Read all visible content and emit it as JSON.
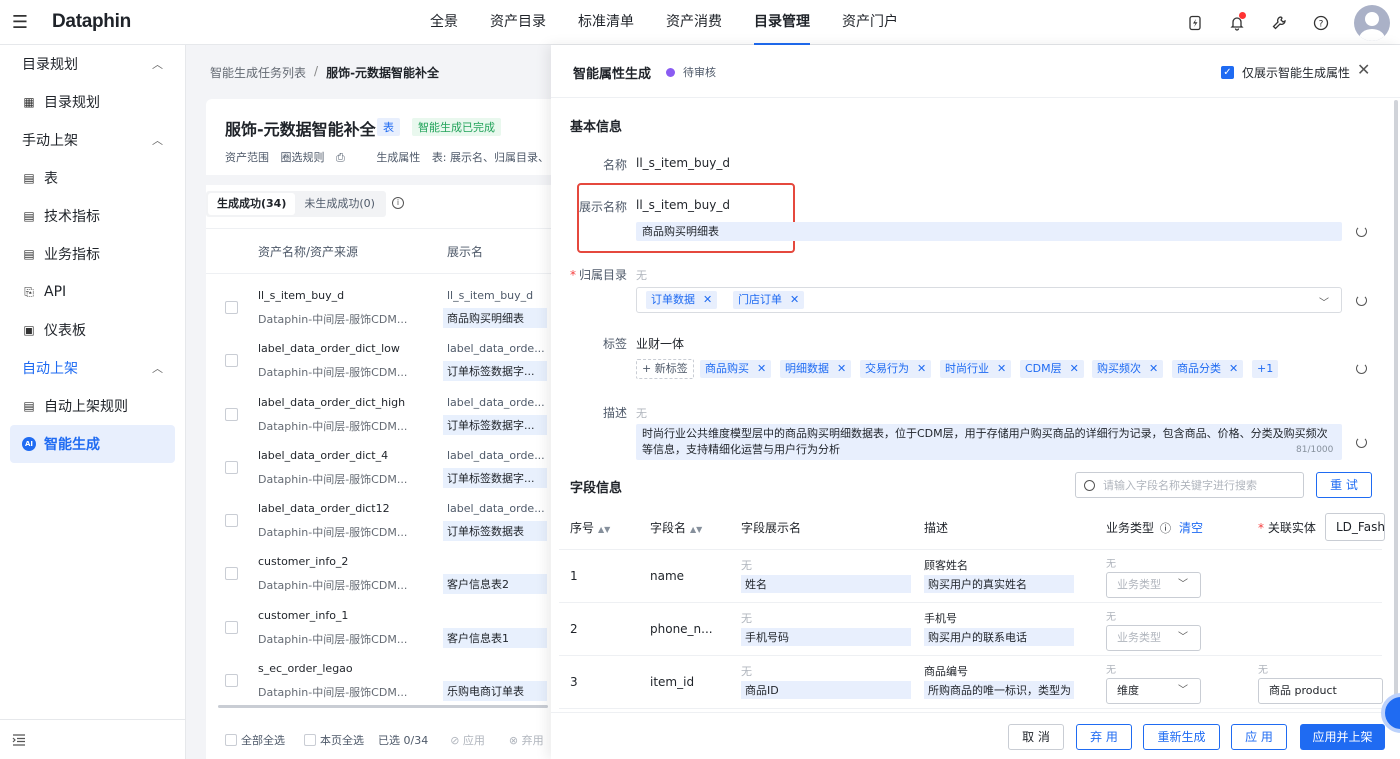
{
  "topbar": {
    "logo": "Dataphin",
    "nav": [
      "全景",
      "资产目录",
      "标准清单",
      "资产消费",
      "目录管理",
      "资产门户"
    ],
    "active_nav": "目录管理"
  },
  "sidebar": {
    "groups": [
      {
        "label": "目录规划",
        "items": [
          {
            "label": "目录规划",
            "icon": "grid-icon"
          }
        ]
      },
      {
        "label": "手动上架",
        "items": [
          {
            "label": "表",
            "icon": "table-icon"
          },
          {
            "label": "技术指标",
            "icon": "metric-icon"
          },
          {
            "label": "业务指标",
            "icon": "biz-metric-icon"
          },
          {
            "label": "API",
            "icon": "api-icon"
          },
          {
            "label": "仪表板",
            "icon": "dashboard-icon"
          }
        ]
      },
      {
        "label": "自动上架",
        "items": [
          {
            "label": "自动上架规则",
            "icon": "rule-icon"
          },
          {
            "label": "智能生成",
            "icon": "ai-icon"
          }
        ]
      }
    ]
  },
  "breadcrumb": {
    "parent": "智能生成任务列表",
    "current": "服饰-元数据智能补全"
  },
  "task": {
    "title": "服饰-元数据智能补全",
    "type_tag": "表",
    "status_tag": "智能生成已完成",
    "meta_scope_label": "资产范围",
    "meta_scope_value": "圈选规则",
    "meta_attr_label": "生成属性",
    "meta_attr_value": "表: 展示名、归属目录、"
  },
  "list": {
    "tab_success": "生成成功(34)",
    "tab_fail": "未生成成功(0)",
    "col_name": "资产名称/资产来源",
    "col_display": "展示名",
    "rows": [
      {
        "name": "ll_s_item_buy_d",
        "source": "Dataphin-中间层-服饰CDM...",
        "display_old": "ll_s_item_buy_d",
        "display_new": "商品购买明细表"
      },
      {
        "name": "label_data_order_dict_low",
        "source": "Dataphin-中间层-服饰CDM...",
        "display_old": "label_data_orde...",
        "display_new": "订单标签数据字..."
      },
      {
        "name": "label_data_order_dict_high",
        "source": "Dataphin-中间层-服饰CDM...",
        "display_old": "label_data_orde...",
        "display_new": "订单标签数据字..."
      },
      {
        "name": "label_data_order_dict_4",
        "source": "Dataphin-中间层-服饰CDM...",
        "display_old": "label_data_orde...",
        "display_new": "订单标签数据字..."
      },
      {
        "name": "label_data_order_dict12",
        "source": "Dataphin-中间层-服饰CDM...",
        "display_old": "label_data_orde...",
        "display_new": "订单标签数据表"
      },
      {
        "name": "customer_info_2",
        "source": "Dataphin-中间层-服饰CDM...",
        "display_old": "",
        "display_new": "客户信息表2"
      },
      {
        "name": "customer_info_1",
        "source": "Dataphin-中间层-服饰CDM...",
        "display_old": "",
        "display_new": "客户信息表1"
      },
      {
        "name": "s_ec_order_legao",
        "source": "Dataphin-中间层-服饰CDM...",
        "display_old": "",
        "display_new": "乐购电商订单表"
      }
    ],
    "footer": {
      "select_all": "全部全选",
      "select_page": "本页全选",
      "selected": "已选 0/34",
      "apply": "应用",
      "discard": "弃用"
    }
  },
  "drawer": {
    "title": "智能属性生成",
    "status": "待审核",
    "only_show_label": "仅展示智能生成属性",
    "basic_title": "基本信息",
    "name_label": "名称",
    "name_value": "ll_s_item_buy_d",
    "display_label": "展示名称",
    "display_value": "ll_s_item_buy_d",
    "display_ai": "商品购买明细表",
    "catalog_label": "归属目录",
    "catalog_value": "无",
    "catalog_chips": [
      "订单数据",
      "门店订单"
    ],
    "tags_label": "标签",
    "tags_value": "业财一体",
    "new_tag": "+ 新标签",
    "tag_chips": [
      "商品购买",
      "明细数据",
      "交易行为",
      "时尚行业",
      "CDM层",
      "购买频次",
      "商品分类"
    ],
    "tag_more": "+1",
    "desc_label": "描述",
    "desc_value": "无",
    "desc_ai": "时尚行业公共维度模型层中的商品购买明细数据表，位于CDM层，用于存储用户购买商品的详细行为记录，包含商品、价格、分类及购买频次等信息，支持精细化运营与用户行为分析",
    "desc_counter": "81/1000",
    "field_title": "字段信息",
    "search_placeholder": "请输入字段名称关键字进行搜索",
    "reset": "重 试",
    "columns": {
      "no": "序号",
      "field": "字段名",
      "display": "字段展示名",
      "desc": "描述",
      "biz": "业务类型",
      "clear": "清空",
      "rel": "关联实体"
    },
    "rel_value": "LD_Fashi",
    "fields": [
      {
        "no": "1",
        "name": "name",
        "display_old": "无",
        "display_new": "姓名",
        "desc_old": "顾客姓名",
        "desc_new": "购买用户的真实姓名",
        "biz_old": "无",
        "biz": "业务类型",
        "rel_old": "",
        "rel": ""
      },
      {
        "no": "2",
        "name": "phone_n...",
        "display_old": "无",
        "display_new": "手机号码",
        "desc_old": "手机号",
        "desc_new": "购买用户的联系电话",
        "biz_old": "无",
        "biz": "业务类型",
        "rel_old": "",
        "rel": ""
      },
      {
        "no": "3",
        "name": "item_id",
        "display_old": "无",
        "display_new": "商品ID",
        "desc_old": "商品编号",
        "desc_new": "所购商品的唯一标识，类型为",
        "biz_old": "无",
        "biz": "维度",
        "rel_old": "无",
        "rel": "商品 product"
      }
    ],
    "buttons": {
      "cancel": "取 消",
      "discard": "弃 用",
      "regen": "重新生成",
      "apply": "应 用",
      "apply_publish": "应用并上架"
    }
  }
}
